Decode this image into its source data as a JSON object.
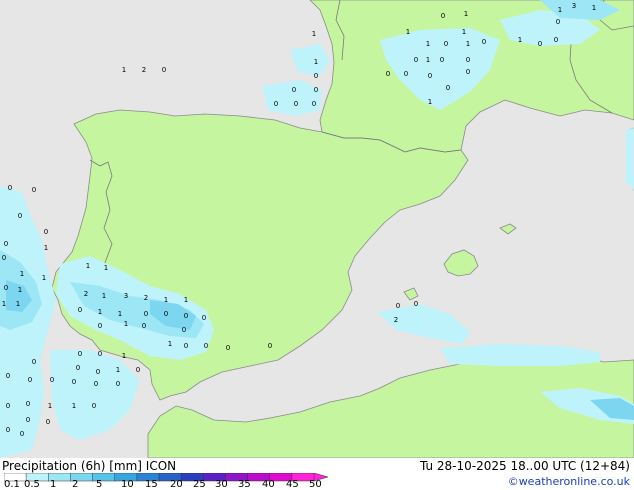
{
  "title": "Precipitation (6h) [mm] ICON",
  "valid_time": "Tu 28-10-2025 18..00 UTC (12+84)",
  "credit": "©weatheronline.co.uk",
  "colors": {
    "sea": "#e6e6e6",
    "land": "#c6f5a0",
    "border": "#7a7a7a",
    "coast": "#8a8a8a"
  },
  "legend": {
    "ticks": [
      "0.1",
      "0.5",
      "1",
      "2",
      "5",
      "10",
      "15",
      "20",
      "25",
      "30",
      "35",
      "40",
      "45",
      "50"
    ],
    "colors": [
      "#ffffff",
      "#bff3fb",
      "#9ce6f5",
      "#7dd6f0",
      "#55c3ea",
      "#36a6dc",
      "#2a84d2",
      "#2862c8",
      "#2a3fbe",
      "#5b21c4",
      "#8f16c8",
      "#b90ccd",
      "#df0ad0",
      "#ff22d8"
    ]
  },
  "value_labels": [
    "1",
    "3",
    "1",
    "0",
    "1",
    "0",
    "1",
    "0",
    "0",
    "1",
    "1",
    "0",
    "1",
    "0",
    "1",
    "1",
    "0",
    "0",
    "1",
    "0",
    "0",
    "0",
    "0",
    "0",
    "0",
    "1",
    "1",
    "0",
    "0",
    "0",
    "0",
    "0",
    "0",
    "1",
    "2",
    "0",
    "0",
    "0",
    "0",
    "0",
    "0",
    "1",
    "0",
    "1",
    "1",
    "0",
    "1",
    "1",
    "1",
    "1",
    "1",
    "2",
    "1",
    "3",
    "2",
    "1",
    "1",
    "0",
    "1",
    "1",
    "0",
    "0",
    "0",
    "0",
    "0",
    "1",
    "0",
    "0",
    "1",
    "0",
    "0",
    "0",
    "0",
    "0",
    "0",
    "1",
    "0",
    "0",
    "1",
    "0",
    "0",
    "0",
    "0",
    "0",
    "0",
    "0",
    "0",
    "0",
    "0",
    "1",
    "1",
    "0",
    "0",
    "0",
    "0",
    "0",
    "0",
    "0",
    "2"
  ]
}
